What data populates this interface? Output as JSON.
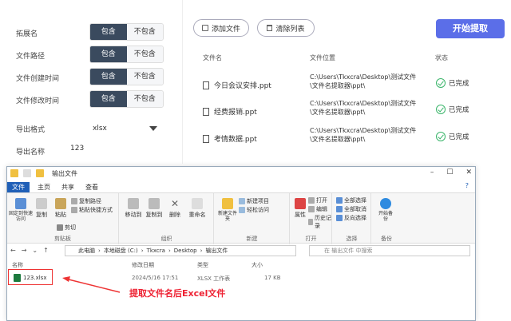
{
  "left_panel": {
    "rows": [
      {
        "label": "拓展名",
        "on": "包含",
        "off": "不包含"
      },
      {
        "label": "文件路径",
        "on": "包含",
        "off": "不包含"
      },
      {
        "label": "文件创建时间",
        "on": "包含",
        "off": "不包含"
      },
      {
        "label": "文件修改时间",
        "on": "包含",
        "off": "不包含"
      }
    ],
    "export_format_label": "导出格式",
    "export_format_value": "xlsx",
    "export_name_label": "导出名称",
    "export_name_value": "123"
  },
  "toolbar": {
    "add_label": "添加文件",
    "clear_label": "清除列表",
    "start_label": "开始提取"
  },
  "table": {
    "headers": [
      "文件名",
      "文件位置",
      "状态"
    ],
    "rows": [
      {
        "name": "今日会议安排.ppt",
        "path1": "C:\\Users\\Tkxcra\\Desktop\\测试文件",
        "path2": "\\文件名提取器\\ppt\\",
        "status": "已完成"
      },
      {
        "name": "经费报销.ppt",
        "path1": "C:\\Users\\Tkxcra\\Desktop\\测试文件",
        "path2": "\\文件名提取器\\ppt\\",
        "status": "已完成"
      },
      {
        "name": "考情数据.ppt",
        "path1": "C:\\Users\\Tkxcra\\Desktop\\测试文件",
        "path2": "\\文件名提取器\\ppt\\",
        "status": "已完成"
      }
    ]
  },
  "explorer": {
    "title": "输出文件",
    "tabs": [
      "文件",
      "主页",
      "共享",
      "查看"
    ],
    "ribbon": {
      "pin": "固定到快速访问",
      "copy": "复制",
      "paste": "粘贴",
      "copy_path": "复制路径",
      "paste_shortcut": "粘贴快捷方式",
      "cut": "剪切",
      "clipboard": "剪贴板",
      "move_to": "移动到",
      "copy_to": "复制到",
      "delete": "删除",
      "rename": "重命名",
      "organize": "组织",
      "new_folder": "新建文件夹",
      "new_item": "新建项目",
      "easy_access": "轻松访问",
      "new": "新建",
      "properties": "属性",
      "open": "打开",
      "edit": "编辑",
      "history": "历史记录",
      "open_group": "打开",
      "select_all": "全部选择",
      "select_none": "全部取消",
      "invert": "反向选择",
      "select": "选择",
      "backup": "开始备份",
      "backup_group": "备份"
    },
    "breadcrumb": [
      "此电脑",
      "本地磁盘 (C:)",
      "Tkxcra",
      "Desktop",
      "输出文件"
    ],
    "search_placeholder": "在 输出文件 中搜索",
    "columns": [
      "名称",
      "修改日期",
      "类型",
      "大小"
    ],
    "file": {
      "name": "123.xlsx",
      "date": "2024/5/16 17:51",
      "type": "XLSX 工作表",
      "size": "17 KB"
    }
  },
  "annotation": "提取文件名后Excel文件",
  "colors": {
    "accent": "#5b6ee8",
    "toggle_on": "#3a4a5e",
    "success": "#3ab56a",
    "annotation": "#e23",
    "excel": "#1d7a3e"
  }
}
